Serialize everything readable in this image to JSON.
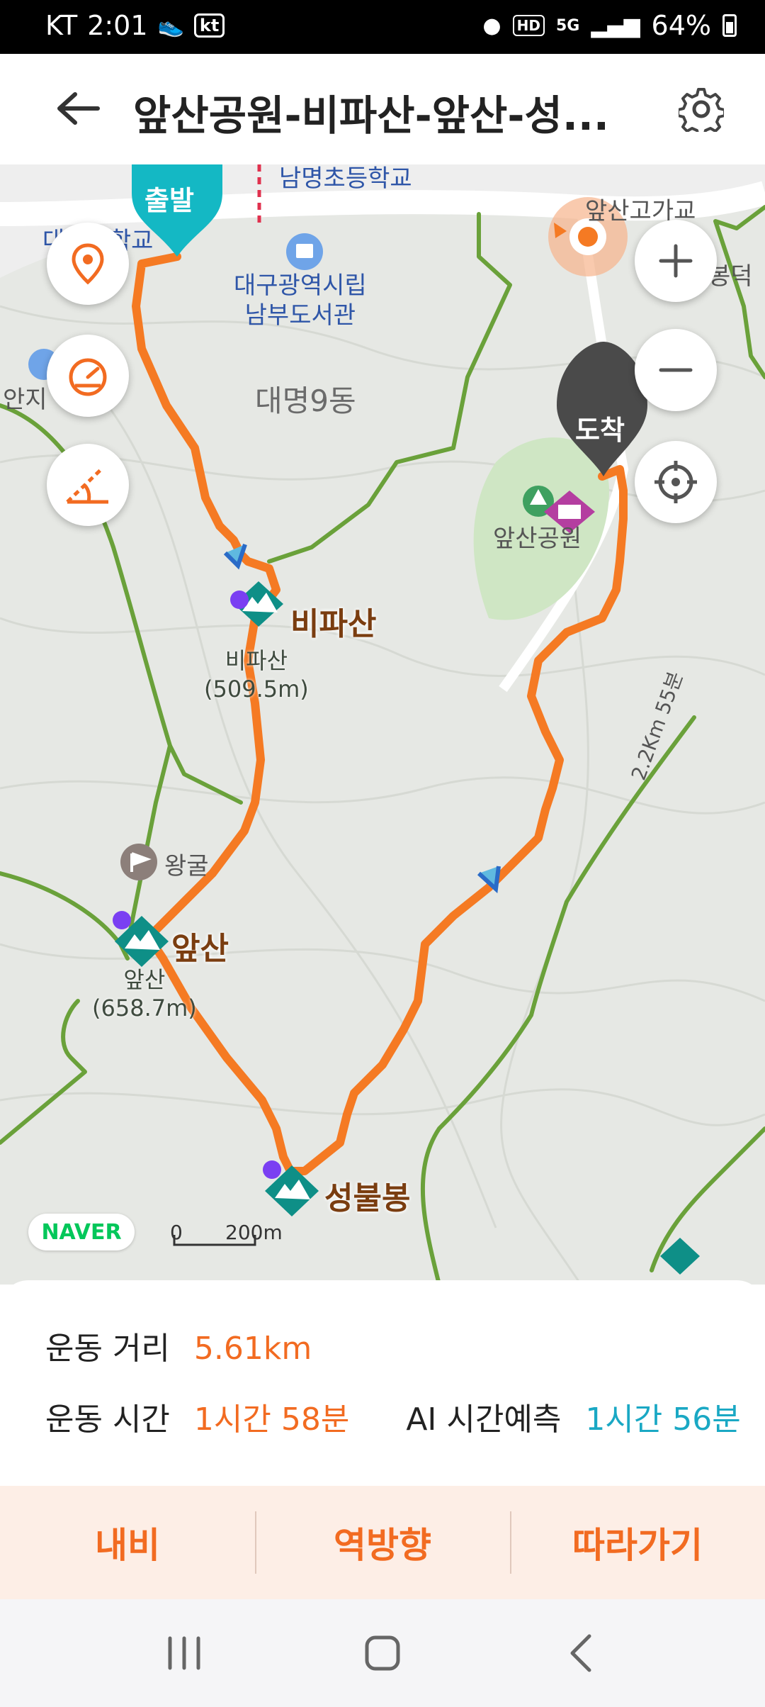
{
  "status_bar": {
    "carrier": "KT",
    "time": "2:01",
    "kt_badge": "kt",
    "network": "5G",
    "hd_badge": "HD",
    "battery": "64%"
  },
  "header": {
    "title": "앞산공원-비파산-앞산-성..."
  },
  "map": {
    "labels": {
      "top_school": "남명초등학교",
      "left_school": "대명중학교",
      "library": "대구광역시립\n남부도서관",
      "dong": "대명9동",
      "left_edge": "안지",
      "bridge": "앞산고가교",
      "right_edge": "봉덕",
      "park": "앞산공원",
      "cave": "왕굴",
      "trail_dist": "2.2Km 55분"
    },
    "peaks": [
      {
        "name": "비파산",
        "sub": "비파산\n(509.5m)"
      },
      {
        "name": "앞산",
        "sub": "앞산\n(658.7m)"
      },
      {
        "name": "성불봉",
        "sub": ""
      }
    ],
    "start_label": "출발",
    "end_label": "도착",
    "naver": "NAVER",
    "scale_zero": "0",
    "scale_label": "200m"
  },
  "info": {
    "distance_label": "운동 거리",
    "distance_value": "5.61km",
    "time_label": "운동 시간",
    "time_value": "1시간 58분",
    "ai_label": "AI 시간예측",
    "ai_value": "1시간 56분"
  },
  "actions": {
    "navi": "내비",
    "reverse": "역방향",
    "follow": "따라가기"
  },
  "colors": {
    "route": "#f57a23",
    "trail": "#6aa13a",
    "start_pin": "#14b8c4",
    "end_pin": "#4a4a4a",
    "accent": "#f26b21",
    "ai": "#1aa8c4"
  }
}
